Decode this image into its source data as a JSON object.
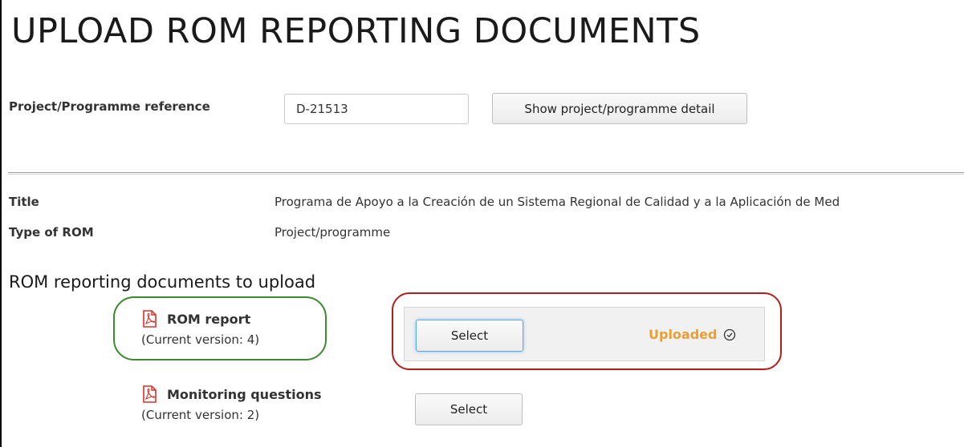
{
  "page": {
    "title": "UPLOAD ROM REPORTING DOCUMENTS"
  },
  "reference": {
    "label": "Project/Programme reference",
    "value": "D-21513",
    "show_detail_button": "Show project/programme detail"
  },
  "details": {
    "title_label": "Title",
    "title_value": "Programa de Apoyo a la Creación de un Sistema Regional de Calidad y a la Aplicación de Med",
    "type_label": "Type of ROM",
    "type_value": "Project/programme"
  },
  "documents_section": {
    "heading": "ROM reporting documents to upload",
    "items": [
      {
        "name": "ROM report",
        "version": "(Current version: 4)",
        "icon": "pdf-icon",
        "select_label": "Select",
        "status": "Uploaded",
        "status_icon": "check-circle-icon"
      },
      {
        "name": "Monitoring questions",
        "version": "(Current version: 2)",
        "icon": "pdf-icon",
        "select_label": "Select"
      }
    ]
  },
  "colors": {
    "uploaded_status": "#e8a035",
    "pdf_icon": "#d8322a",
    "highlight_green": "#3a8a2e",
    "highlight_red": "#b71c1c",
    "active_button_border": "#5aa9e6"
  }
}
